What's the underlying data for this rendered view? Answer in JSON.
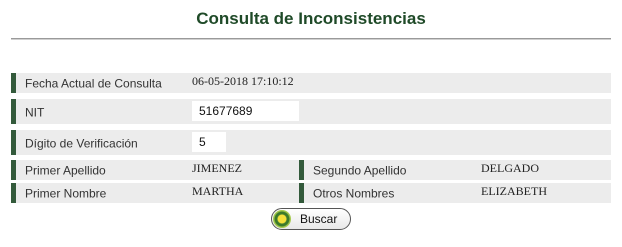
{
  "page": {
    "title": "Consulta de Inconsistencias"
  },
  "form": {
    "fecha": {
      "label": "Fecha Actual de Consulta",
      "value": "06-05-2018 17:10:12"
    },
    "nit": {
      "label": "NIT",
      "value": "51677689"
    },
    "digito": {
      "label": "Dígito de Verificación",
      "value": "5"
    },
    "primer_apellido": {
      "label": "Primer Apellido",
      "value": "JIMENEZ"
    },
    "segundo_apellido": {
      "label": "Segundo Apellido",
      "value": "DELGADO"
    },
    "primer_nombre": {
      "label": "Primer Nombre",
      "value": "MARTHA"
    },
    "otros_nombres": {
      "label": "Otros Nombres",
      "value": "ELIZABETH"
    }
  },
  "actions": {
    "buscar_label": "Buscar",
    "buscar_icon": "green-circle-icon"
  },
  "colors": {
    "title": "#1f4a28",
    "label_bar": "#335a3b",
    "row_bg": "#ececec"
  }
}
